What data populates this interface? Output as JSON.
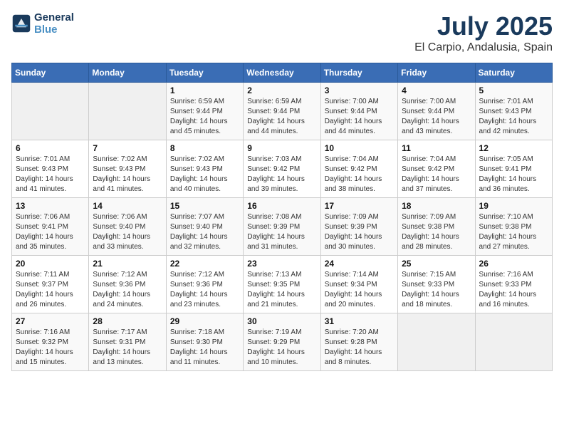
{
  "header": {
    "logo_line1": "General",
    "logo_line2": "Blue",
    "month": "July 2025",
    "location": "El Carpio, Andalusia, Spain"
  },
  "weekdays": [
    "Sunday",
    "Monday",
    "Tuesday",
    "Wednesday",
    "Thursday",
    "Friday",
    "Saturday"
  ],
  "weeks": [
    [
      {
        "day": "",
        "info": ""
      },
      {
        "day": "",
        "info": ""
      },
      {
        "day": "1",
        "info": "Sunrise: 6:59 AM\nSunset: 9:44 PM\nDaylight: 14 hours\nand 45 minutes."
      },
      {
        "day": "2",
        "info": "Sunrise: 6:59 AM\nSunset: 9:44 PM\nDaylight: 14 hours\nand 44 minutes."
      },
      {
        "day": "3",
        "info": "Sunrise: 7:00 AM\nSunset: 9:44 PM\nDaylight: 14 hours\nand 44 minutes."
      },
      {
        "day": "4",
        "info": "Sunrise: 7:00 AM\nSunset: 9:44 PM\nDaylight: 14 hours\nand 43 minutes."
      },
      {
        "day": "5",
        "info": "Sunrise: 7:01 AM\nSunset: 9:43 PM\nDaylight: 14 hours\nand 42 minutes."
      }
    ],
    [
      {
        "day": "6",
        "info": "Sunrise: 7:01 AM\nSunset: 9:43 PM\nDaylight: 14 hours\nand 41 minutes."
      },
      {
        "day": "7",
        "info": "Sunrise: 7:02 AM\nSunset: 9:43 PM\nDaylight: 14 hours\nand 41 minutes."
      },
      {
        "day": "8",
        "info": "Sunrise: 7:02 AM\nSunset: 9:43 PM\nDaylight: 14 hours\nand 40 minutes."
      },
      {
        "day": "9",
        "info": "Sunrise: 7:03 AM\nSunset: 9:42 PM\nDaylight: 14 hours\nand 39 minutes."
      },
      {
        "day": "10",
        "info": "Sunrise: 7:04 AM\nSunset: 9:42 PM\nDaylight: 14 hours\nand 38 minutes."
      },
      {
        "day": "11",
        "info": "Sunrise: 7:04 AM\nSunset: 9:42 PM\nDaylight: 14 hours\nand 37 minutes."
      },
      {
        "day": "12",
        "info": "Sunrise: 7:05 AM\nSunset: 9:41 PM\nDaylight: 14 hours\nand 36 minutes."
      }
    ],
    [
      {
        "day": "13",
        "info": "Sunrise: 7:06 AM\nSunset: 9:41 PM\nDaylight: 14 hours\nand 35 minutes."
      },
      {
        "day": "14",
        "info": "Sunrise: 7:06 AM\nSunset: 9:40 PM\nDaylight: 14 hours\nand 33 minutes."
      },
      {
        "day": "15",
        "info": "Sunrise: 7:07 AM\nSunset: 9:40 PM\nDaylight: 14 hours\nand 32 minutes."
      },
      {
        "day": "16",
        "info": "Sunrise: 7:08 AM\nSunset: 9:39 PM\nDaylight: 14 hours\nand 31 minutes."
      },
      {
        "day": "17",
        "info": "Sunrise: 7:09 AM\nSunset: 9:39 PM\nDaylight: 14 hours\nand 30 minutes."
      },
      {
        "day": "18",
        "info": "Sunrise: 7:09 AM\nSunset: 9:38 PM\nDaylight: 14 hours\nand 28 minutes."
      },
      {
        "day": "19",
        "info": "Sunrise: 7:10 AM\nSunset: 9:38 PM\nDaylight: 14 hours\nand 27 minutes."
      }
    ],
    [
      {
        "day": "20",
        "info": "Sunrise: 7:11 AM\nSunset: 9:37 PM\nDaylight: 14 hours\nand 26 minutes."
      },
      {
        "day": "21",
        "info": "Sunrise: 7:12 AM\nSunset: 9:36 PM\nDaylight: 14 hours\nand 24 minutes."
      },
      {
        "day": "22",
        "info": "Sunrise: 7:12 AM\nSunset: 9:36 PM\nDaylight: 14 hours\nand 23 minutes."
      },
      {
        "day": "23",
        "info": "Sunrise: 7:13 AM\nSunset: 9:35 PM\nDaylight: 14 hours\nand 21 minutes."
      },
      {
        "day": "24",
        "info": "Sunrise: 7:14 AM\nSunset: 9:34 PM\nDaylight: 14 hours\nand 20 minutes."
      },
      {
        "day": "25",
        "info": "Sunrise: 7:15 AM\nSunset: 9:33 PM\nDaylight: 14 hours\nand 18 minutes."
      },
      {
        "day": "26",
        "info": "Sunrise: 7:16 AM\nSunset: 9:33 PM\nDaylight: 14 hours\nand 16 minutes."
      }
    ],
    [
      {
        "day": "27",
        "info": "Sunrise: 7:16 AM\nSunset: 9:32 PM\nDaylight: 14 hours\nand 15 minutes."
      },
      {
        "day": "28",
        "info": "Sunrise: 7:17 AM\nSunset: 9:31 PM\nDaylight: 14 hours\nand 13 minutes."
      },
      {
        "day": "29",
        "info": "Sunrise: 7:18 AM\nSunset: 9:30 PM\nDaylight: 14 hours\nand 11 minutes."
      },
      {
        "day": "30",
        "info": "Sunrise: 7:19 AM\nSunset: 9:29 PM\nDaylight: 14 hours\nand 10 minutes."
      },
      {
        "day": "31",
        "info": "Sunrise: 7:20 AM\nSunset: 9:28 PM\nDaylight: 14 hours\nand 8 minutes."
      },
      {
        "day": "",
        "info": ""
      },
      {
        "day": "",
        "info": ""
      }
    ]
  ]
}
